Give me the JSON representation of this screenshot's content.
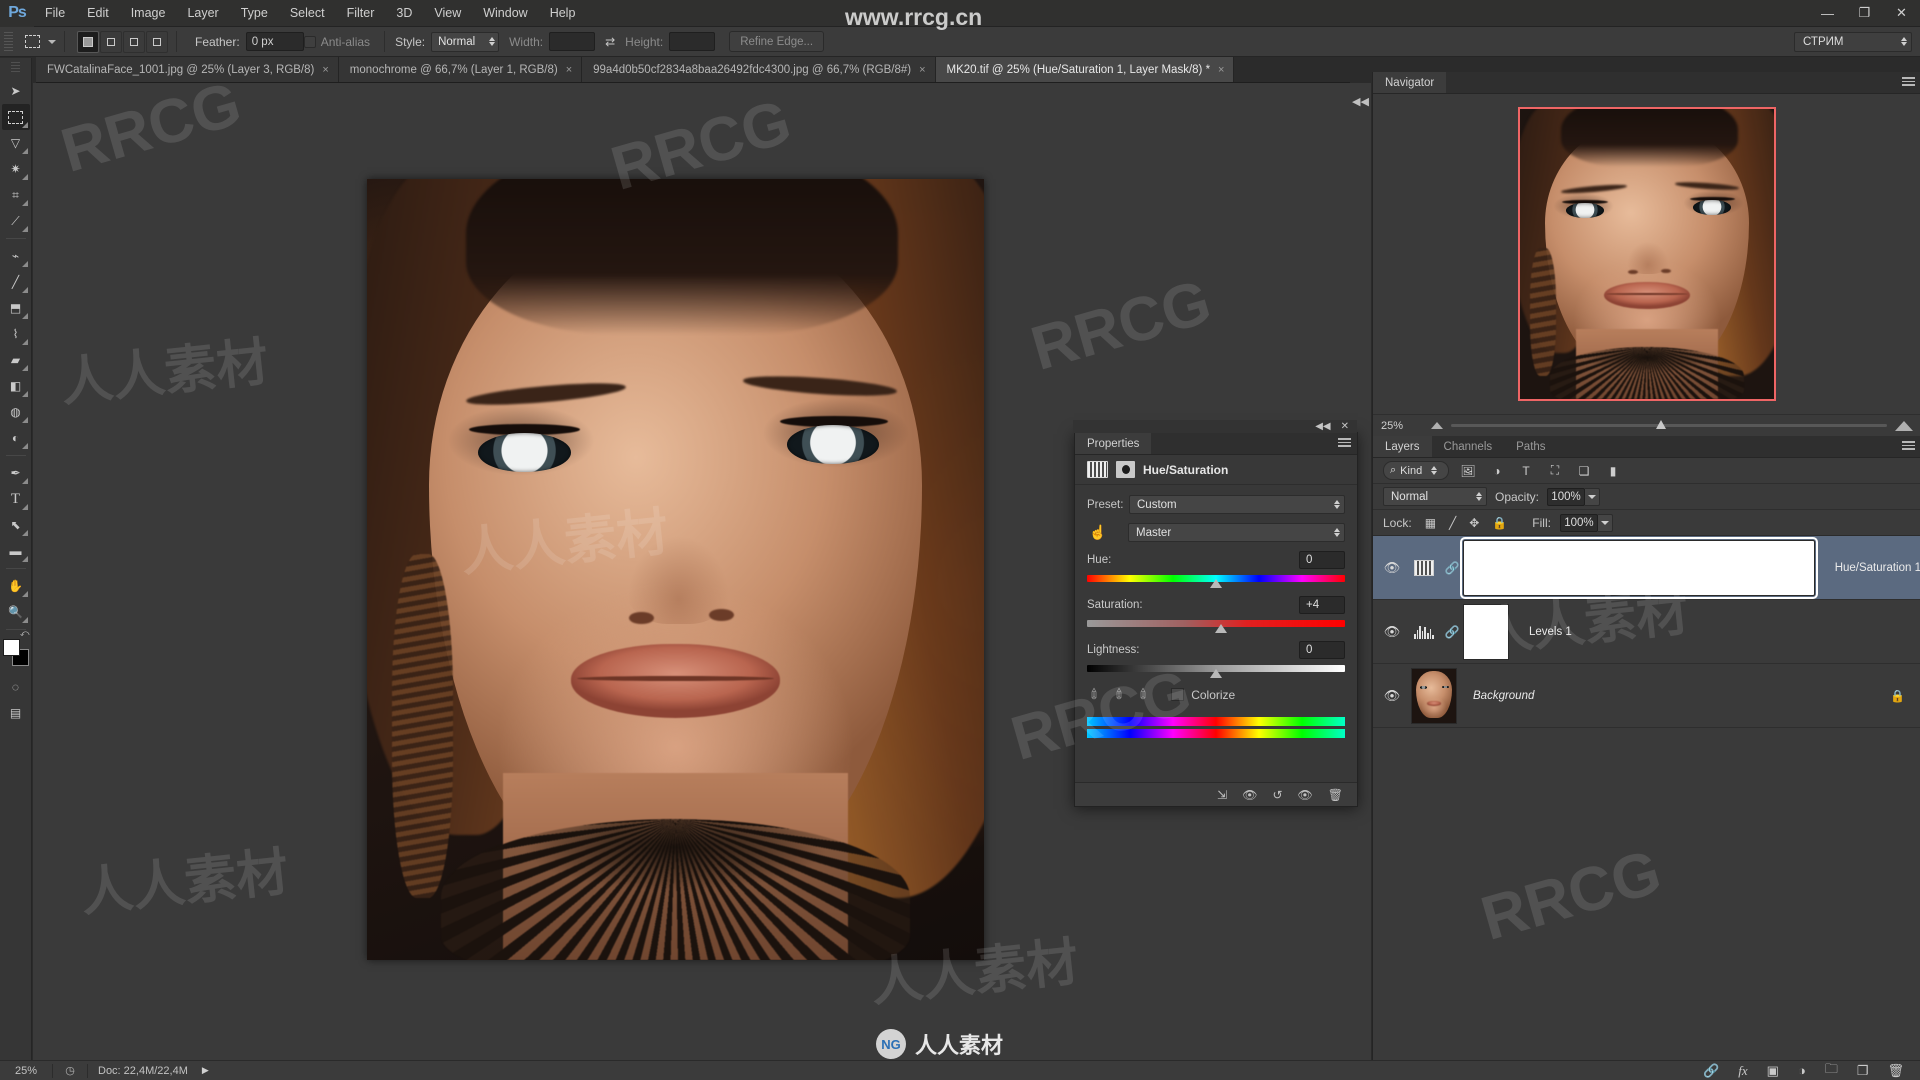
{
  "app": {
    "logo": "Ps",
    "menus": [
      "File",
      "Edit",
      "Image",
      "Layer",
      "Type",
      "Select",
      "Filter",
      "3D",
      "View",
      "Window",
      "Help"
    ],
    "window_controls": {
      "minimize": "—",
      "restore": "❐",
      "close": "✕"
    }
  },
  "options_bar": {
    "tool": "rectangular-marquee",
    "feather_label": "Feather:",
    "feather_value": "0 px",
    "antialias_label": "Anti-alias",
    "style_label": "Style:",
    "style_value": "Normal",
    "width_label": "Width:",
    "width_value": "",
    "height_label": "Height:",
    "height_value": "",
    "refine_edge_label": "Refine Edge...",
    "workspace": "СТРИМ"
  },
  "tabs": [
    {
      "label": "FWCatalinaFace_1001.jpg @ 25% (Layer 3, RGB/8)",
      "active": false,
      "close": "×"
    },
    {
      "label": "monochrome @ 66,7% (Layer 1, RGB/8)",
      "active": false,
      "close": "×"
    },
    {
      "label": "99a4d0b50cf2834a8baa26492fdc4300.jpg @ 66,7% (RGB/8#)",
      "active": false,
      "close": "×"
    },
    {
      "label": "MK20.tif @ 25% (Hue/Saturation 1, Layer Mask/8) *",
      "active": true,
      "close": "×"
    }
  ],
  "toolbar": {
    "tools": [
      {
        "name": "move-tool",
        "glyph": "➤",
        "active": false
      },
      {
        "name": "rectangular-marquee-tool",
        "glyph": "▭",
        "active": true
      },
      {
        "name": "lasso-tool",
        "glyph": "⌒",
        "active": false
      },
      {
        "name": "quick-selection-tool",
        "glyph": "✦",
        "active": false
      },
      {
        "name": "crop-tool",
        "glyph": "⌗",
        "active": false
      },
      {
        "name": "eyedropper-tool",
        "glyph": "✎",
        "active": false
      },
      {
        "name": "spot-healing-brush-tool",
        "glyph": "⌁",
        "active": false
      },
      {
        "name": "brush-tool",
        "glyph": "🖌",
        "active": false
      },
      {
        "name": "clone-stamp-tool",
        "glyph": "⚲",
        "active": false
      },
      {
        "name": "history-brush-tool",
        "glyph": "❧",
        "active": false
      },
      {
        "name": "eraser-tool",
        "glyph": "◣",
        "active": false
      },
      {
        "name": "gradient-tool",
        "glyph": "◨",
        "active": false
      },
      {
        "name": "blur-tool",
        "glyph": "💧",
        "active": false
      },
      {
        "name": "dodge-tool",
        "glyph": "◐",
        "active": false
      },
      {
        "name": "pen-tool",
        "glyph": "✒",
        "active": false
      },
      {
        "name": "type-tool",
        "glyph": "T",
        "active": false
      },
      {
        "name": "path-selection-tool",
        "glyph": "⬈",
        "active": false
      },
      {
        "name": "rectangle-tool",
        "glyph": "▬",
        "active": false
      },
      {
        "name": "hand-tool",
        "glyph": "✋",
        "active": false
      },
      {
        "name": "zoom-tool",
        "glyph": "🔍",
        "active": false
      }
    ],
    "foreground_color": "#ffffff",
    "background_color": "#000000"
  },
  "properties_panel": {
    "panel_tab": "Properties",
    "adjustment_title": "Hue/Saturation",
    "preset_label": "Preset:",
    "preset_value": "Custom",
    "channel_value": "Master",
    "sliders": [
      {
        "name": "Hue:",
        "value": "0",
        "pos_pct": 50
      },
      {
        "name": "Saturation:",
        "value": "+4",
        "pos_pct": 52
      },
      {
        "name": "Lightness:",
        "value": "0",
        "pos_pct": 50
      }
    ],
    "colorize_label": "Colorize",
    "footer_icons": [
      "clip-to-layer-icon",
      "view-previous-state-icon",
      "reset-icon",
      "toggle-visibility-icon",
      "delete-icon"
    ]
  },
  "navigator": {
    "panel_tab": "Navigator",
    "zoom_value": "25%",
    "view_box_color": "#ef6565"
  },
  "layers_panel": {
    "tabs": [
      {
        "label": "Layers",
        "active": true
      },
      {
        "label": "Channels",
        "active": false
      },
      {
        "label": "Paths",
        "active": false
      }
    ],
    "filter_kind": "Kind",
    "filter_icons": [
      "pixel-filter-icon",
      "adjustment-filter-icon",
      "type-filter-icon",
      "shape-filter-icon",
      "smart-object-filter-icon",
      "filter-toggle-icon"
    ],
    "blend_mode": "Normal",
    "opacity_label": "Opacity:",
    "opacity_value": "100%",
    "lock_label": "Lock:",
    "lock_icons": [
      "lock-transparent-pixels-icon",
      "lock-image-pixels-icon",
      "lock-position-icon",
      "lock-all-icon"
    ],
    "fill_label": "Fill:",
    "fill_value": "100%",
    "layers": [
      {
        "name": "Hue/Saturation 1",
        "type": "adjustment-huesat",
        "selected": true,
        "visible": true,
        "locked": false,
        "has_mask": true,
        "mask_selected": true
      },
      {
        "name": "Levels 1",
        "type": "adjustment-levels",
        "selected": false,
        "visible": true,
        "locked": false,
        "has_mask": true,
        "mask_selected": false
      },
      {
        "name": "Background",
        "type": "image",
        "selected": false,
        "visible": true,
        "locked": true,
        "has_mask": false,
        "mask_selected": false
      }
    ],
    "footer_icons": [
      "link-layers-icon",
      "layer-style-icon",
      "add-layer-mask-icon",
      "new-adjustment-layer-icon",
      "new-group-icon",
      "new-layer-icon",
      "delete-layer-icon"
    ]
  },
  "status_bar": {
    "zoom": "25%",
    "doc_label": "Doc: 22,4M/22,4M",
    "arrow": "▶"
  },
  "watermarks": {
    "site": "www.rrcg.cn",
    "brand": "RRCG",
    "cn_text": "人人素材",
    "logo_letters": "NG"
  },
  "colors": {
    "panel_bg": "#3a3a3a",
    "menu_bg": "#30302f",
    "selected_layer": "#5b6a80",
    "accent_blue": "#6fa8dc",
    "navigator_box": "#ef6565"
  }
}
